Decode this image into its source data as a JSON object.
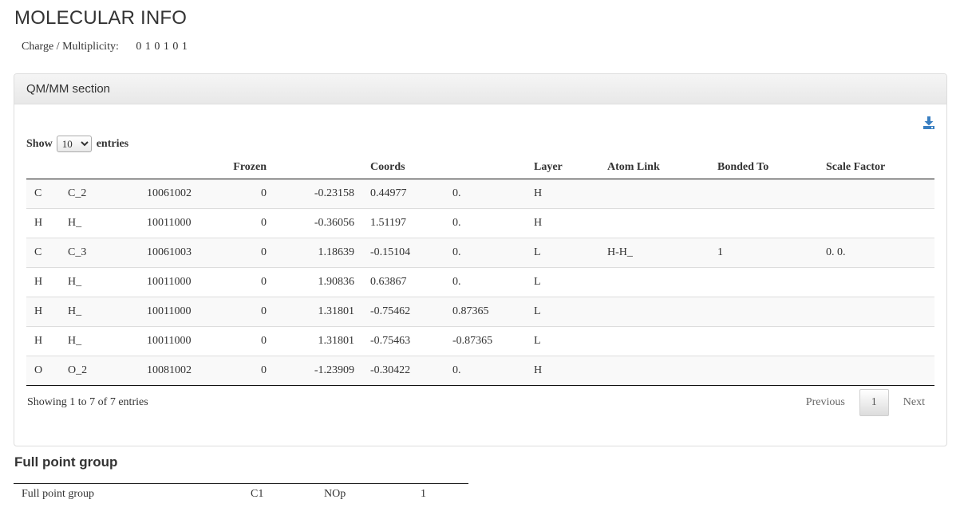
{
  "header": {
    "title": "MOLECULAR INFO",
    "charge_label": "Charge / Multiplicity:",
    "charge_value": "0 1 0 1 0 1"
  },
  "qmmm": {
    "panel_title": "QM/MM section",
    "download_icon": "download-icon",
    "show_label": "Show",
    "entries_label": "entries",
    "page_length": "10",
    "columns": [
      "",
      "",
      "",
      "Frozen",
      "",
      "Coords",
      "",
      "Layer",
      "Atom Link",
      "Bonded To",
      "Scale Factor"
    ],
    "rows": [
      [
        "C",
        "C_2",
        "10061002",
        "0",
        "-0.23158",
        "0.44977",
        "0.",
        "H",
        "",
        "",
        ""
      ],
      [
        "H",
        "H_",
        "10011000",
        "0",
        "-0.36056",
        "1.51197",
        "0.",
        "H",
        "",
        "",
        ""
      ],
      [
        "C",
        "C_3",
        "10061003",
        "0",
        "1.18639",
        "-0.15104",
        "0.",
        "L",
        "H-H_",
        "1",
        "0. 0."
      ],
      [
        "H",
        "H_",
        "10011000",
        "0",
        "1.90836",
        "0.63867",
        "0.",
        "L",
        "",
        "",
        ""
      ],
      [
        "H",
        "H_",
        "10011000",
        "0",
        "1.31801",
        "-0.75462",
        "0.87365",
        "L",
        "",
        "",
        ""
      ],
      [
        "H",
        "H_",
        "10011000",
        "0",
        "1.31801",
        "-0.75463",
        "-0.87365",
        "L",
        "",
        "",
        ""
      ],
      [
        "O",
        "O_2",
        "10081002",
        "0",
        "-1.23909",
        "-0.30422",
        "0.",
        "H",
        "",
        "",
        ""
      ]
    ],
    "info": "Showing 1 to 7 of 7 entries",
    "pagination": {
      "previous": "Previous",
      "current": "1",
      "next": "Next"
    }
  },
  "point_group": {
    "title": "Full point group",
    "row": [
      "Full point group",
      "C1",
      "NOp",
      "1"
    ]
  }
}
